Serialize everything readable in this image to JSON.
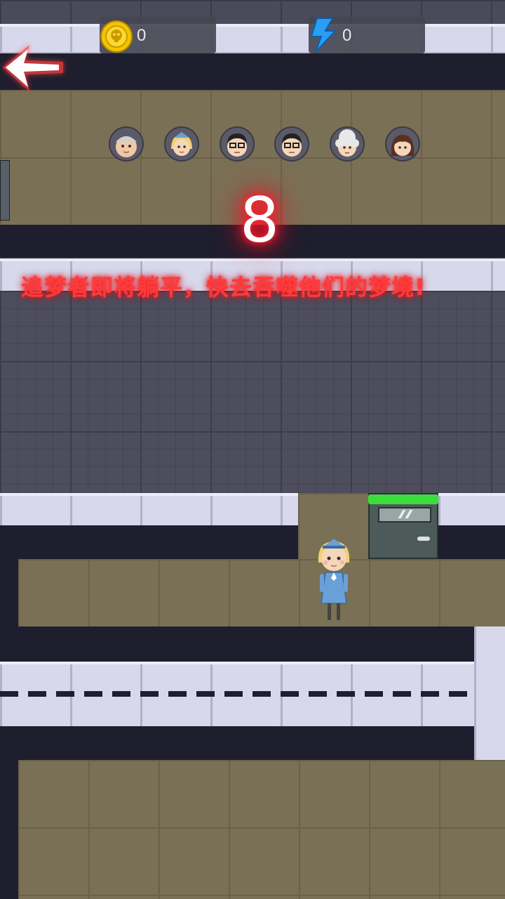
{
  "hud": {
    "coins": "0",
    "energy": "0",
    "coin_icon": "skull-coin-icon",
    "energy_icon": "lightning-icon"
  },
  "back_icon": "back-arrow-icon",
  "players": [
    {
      "name": "old-man-face"
    },
    {
      "name": "stewardess-face"
    },
    {
      "name": "glasses-man-face"
    },
    {
      "name": "glasses-man-2-face"
    },
    {
      "name": "grandma-face"
    },
    {
      "name": "girl-face"
    }
  ],
  "countdown": "8",
  "ticker": "追梦者即将躺平，快去吞噬他们的梦境!",
  "door": {
    "status": "open"
  },
  "colors": {
    "countdown_glow": "#ff2030",
    "ticker": "#ff3a3a",
    "door_bar": "#3cdc3c",
    "coin": "#f5c400",
    "energy": "#2a9df4"
  }
}
